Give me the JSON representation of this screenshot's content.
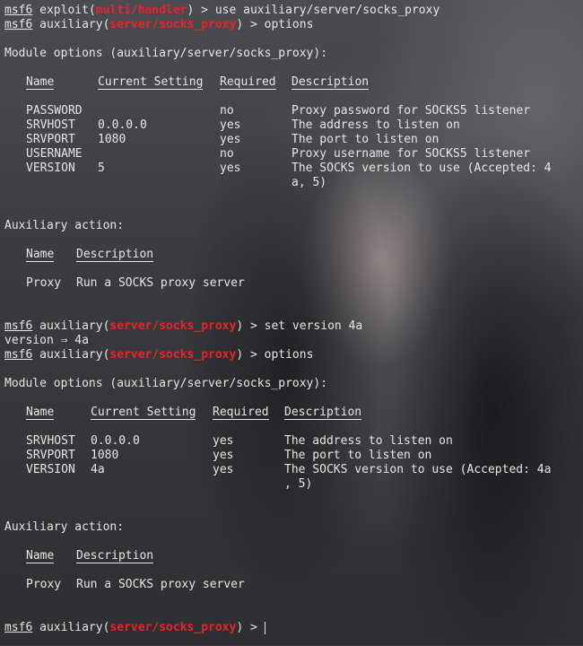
{
  "prompt": {
    "msf": "msf6",
    "close": ") > "
  },
  "lines": {
    "l1": {
      "ctx": "exploit(",
      "mod": "multi/handler",
      "cmd": "use auxiliary/server/socks_proxy"
    },
    "l2": {
      "ctx": "auxiliary(",
      "mod": "server/socks_proxy",
      "cmd": "options"
    },
    "l3": {
      "ctx": "auxiliary(",
      "mod": "server/socks_proxy",
      "cmd": "set version 4a"
    },
    "l4": {
      "ctx": "auxiliary(",
      "mod": "server/socks_proxy",
      "cmd": "options"
    },
    "l5": {
      "ctx": "auxiliary(",
      "mod": "server/socks_proxy",
      "cmd": ""
    }
  },
  "set_result": "version ⇒ 4a",
  "module_options_heading": "Module options (auxiliary/server/socks_proxy):",
  "aux_heading": "Auxiliary action:",
  "headers": {
    "name": "Name",
    "setting": "Current Setting",
    "required": "Required",
    "description": "Description"
  },
  "options1": [
    {
      "name": "PASSWORD",
      "setting": "",
      "required": "no",
      "description": "Proxy password for SOCKS5 listener"
    },
    {
      "name": "SRVHOST",
      "setting": "0.0.0.0",
      "required": "yes",
      "description": "The address to listen on"
    },
    {
      "name": "SRVPORT",
      "setting": "1080",
      "required": "yes",
      "description": "The port to listen on"
    },
    {
      "name": "USERNAME",
      "setting": "",
      "required": "no",
      "description": "Proxy username for SOCKS5 listener"
    },
    {
      "name": "VERSION",
      "setting": "5",
      "required": "yes",
      "description": "The SOCKS version to use (Accepted: 4",
      "description2": "a, 5)"
    }
  ],
  "options2": [
    {
      "name": "SRVHOST",
      "setting": "0.0.0.0",
      "required": "yes",
      "description": "The address to listen on"
    },
    {
      "name": "SRVPORT",
      "setting": "1080",
      "required": "yes",
      "description": "The port to listen on"
    },
    {
      "name": "VERSION",
      "setting": "4a",
      "required": "yes",
      "description": "The SOCKS version to use (Accepted: 4a",
      "description2": ", 5)"
    }
  ],
  "action": {
    "name": "Proxy",
    "description": "Run a SOCKS proxy server"
  }
}
